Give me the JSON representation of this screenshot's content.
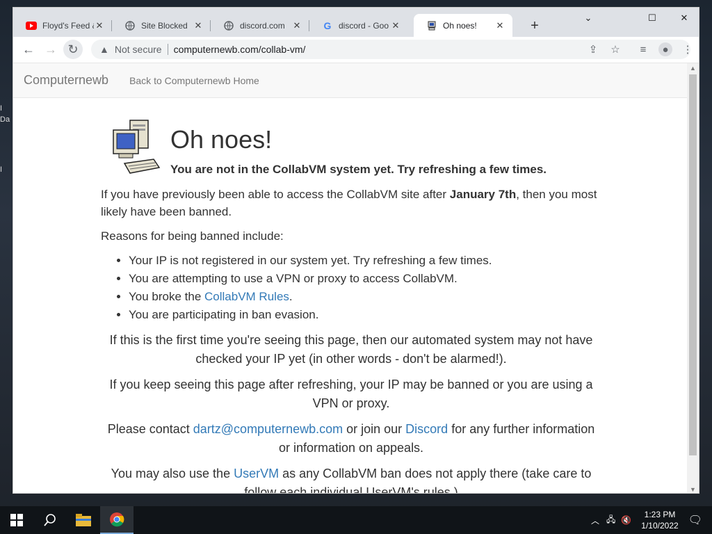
{
  "desktop": {
    "edge_labels": [
      "I",
      "Da",
      "I"
    ]
  },
  "browser": {
    "tabs": [
      {
        "title": "Floyd's Feed &",
        "icon": "youtube-icon",
        "active": false
      },
      {
        "title": "Site Blocked",
        "icon": "globe-icon",
        "active": false
      },
      {
        "title": "discord.com",
        "icon": "globe-icon",
        "active": false
      },
      {
        "title": "discord - Goo",
        "icon": "google-icon",
        "active": false
      },
      {
        "title": "Oh noes!",
        "icon": "computer-icon",
        "active": true
      }
    ],
    "new_tab": "+",
    "address": {
      "security": "Not secure",
      "url": "computernewb.com/collab-vm/"
    }
  },
  "page": {
    "navbar": {
      "brand": "Computernewb",
      "link": "Back to Computernewb Home"
    },
    "title": "Oh noes!",
    "subtitle": "You are not in the CollabVM system yet. Try refreshing a few times.",
    "para1_start": "If you have previously been able to access the CollabVM site after ",
    "para1_bold": "January 7th",
    "para1_end": ", then you most likely have been banned.",
    "reasons_title": "Reasons for being banned include:",
    "reasons": [
      "Your IP is not registered in our system yet. Try refreshing a few times.",
      "You are attempting to use a VPN or proxy to access CollabVM.",
      "You broke the ",
      "You are participating in ban evasion."
    ],
    "rules_link": "CollabVM Rules",
    "rules_after": ".",
    "center1": "If this is the first time you're seeing this page, then our automated system may not have checked your IP yet (in other words - don't be alarmed!).",
    "center2": "If you keep seeing this page after refreshing, your IP may be banned or you are using a VPN or proxy.",
    "contact_pre": "Please contact ",
    "contact_email": "dartz@computernewb.com",
    "contact_mid": " or join our ",
    "contact_discord": "Discord",
    "contact_post": " for any further information or information on appeals.",
    "uservm_pre": "You may also use the ",
    "uservm_link": "UserVM",
    "uservm_post": " as any CollabVM ban does not apply there (take care to follow each individual UserVM's rules.)"
  },
  "taskbar": {
    "time": "1:23 PM",
    "date": "1/10/2022"
  },
  "colors": {
    "link": "#337ab7",
    "text": "#333333",
    "tabstrip": "#dee1e6"
  }
}
